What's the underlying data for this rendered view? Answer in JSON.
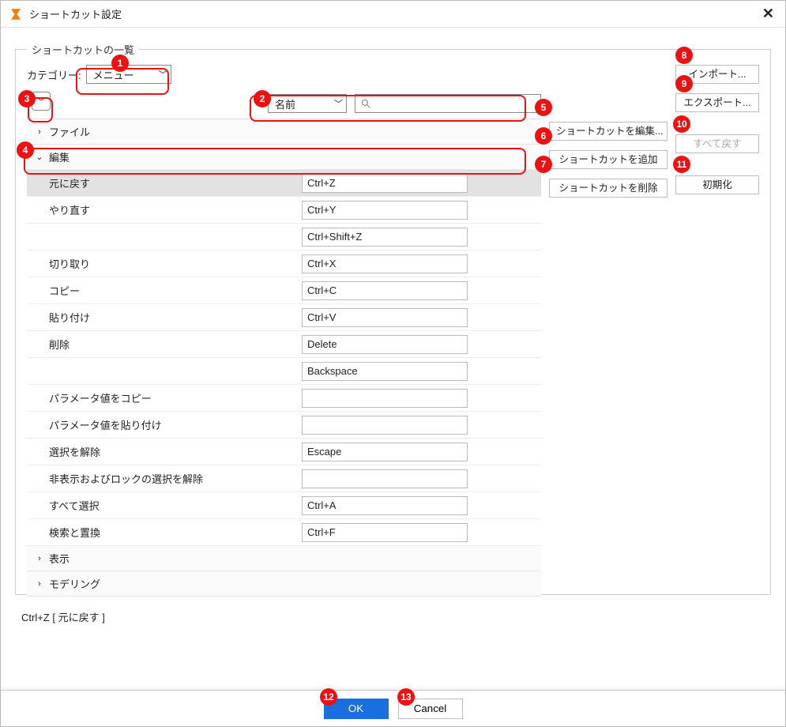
{
  "window": {
    "title": "ショートカット設定"
  },
  "group": {
    "legend": "ショートカットの一覧"
  },
  "category": {
    "label": "カテゴリー:",
    "value": "メニュー"
  },
  "search": {
    "mode": "名前",
    "value": ""
  },
  "buttons": {
    "import": "インポート...",
    "export": "エクスポート...",
    "edit": "ショートカットを編集...",
    "add": "ショートカットを追加",
    "delete": "ショートカットを削除",
    "resetAll": "すべて戻す",
    "init": "初期化",
    "ok": "OK",
    "cancel": "Cancel"
  },
  "groups": [
    {
      "name": "ファイル",
      "expanded": false
    },
    {
      "name": "編集",
      "expanded": true,
      "items": [
        {
          "name": "元に戻す",
          "keys": [
            "Ctrl+Z"
          ],
          "selected": true
        },
        {
          "name": "やり直す",
          "keys": [
            "Ctrl+Y",
            "Ctrl+Shift+Z"
          ]
        },
        {
          "name": "切り取り",
          "keys": [
            "Ctrl+X"
          ]
        },
        {
          "name": "コピー",
          "keys": [
            "Ctrl+C"
          ]
        },
        {
          "name": "貼り付け",
          "keys": [
            "Ctrl+V"
          ]
        },
        {
          "name": "削除",
          "keys": [
            "Delete",
            "Backspace"
          ]
        },
        {
          "name": "パラメータ値をコピー",
          "keys": [
            ""
          ]
        },
        {
          "name": "パラメータ値を貼り付け",
          "keys": [
            ""
          ]
        },
        {
          "name": "選択を解除",
          "keys": [
            "Escape"
          ]
        },
        {
          "name": "非表示およびロックの選択を解除",
          "keys": [
            ""
          ]
        },
        {
          "name": "すべて選択",
          "keys": [
            "Ctrl+A"
          ]
        },
        {
          "name": "検索と置換",
          "keys": [
            "Ctrl+F"
          ]
        }
      ]
    },
    {
      "name": "表示",
      "expanded": false
    },
    {
      "name": "モデリング",
      "expanded": false
    }
  ],
  "status": "Ctrl+Z    [ 元に戻す ]"
}
